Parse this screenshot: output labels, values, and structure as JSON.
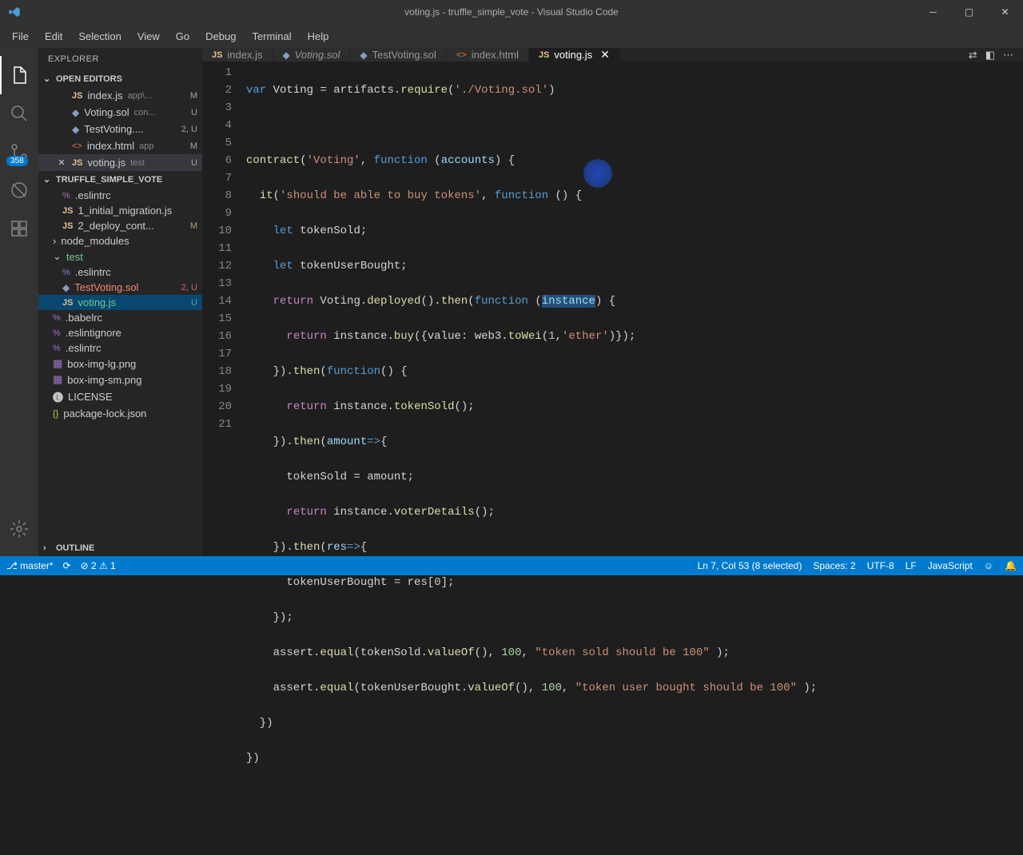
{
  "title": "voting.js - truffle_simple_vote - Visual Studio Code",
  "menu": [
    "File",
    "Edit",
    "Selection",
    "View",
    "Go",
    "Debug",
    "Terminal",
    "Help"
  ],
  "activitybar": {
    "scm_badge": "358"
  },
  "sidebar": {
    "title": "EXPLORER",
    "sections": {
      "open_editors": "OPEN EDITORS",
      "project": "TRUFFLE_SIMPLE_VOTE",
      "outline": "OUTLINE"
    },
    "open_editors": [
      {
        "name": "index.js",
        "meta": "app\\...",
        "status": "M",
        "icon": "js"
      },
      {
        "name": "Voting.sol",
        "meta": "con...",
        "status": "U",
        "icon": "sol"
      },
      {
        "name": "TestVoting....",
        "meta": "",
        "status": "2, U",
        "icon": "sol"
      },
      {
        "name": "index.html",
        "meta": "app",
        "status": "M",
        "icon": "html"
      },
      {
        "name": "voting.js",
        "meta": "test",
        "status": "U",
        "icon": "js",
        "close": true,
        "active": true
      }
    ],
    "tree": [
      {
        "name": ".eslintrc",
        "indent": 1,
        "icon": "yml"
      },
      {
        "name": "1_initial_migration.js",
        "indent": 1,
        "icon": "js"
      },
      {
        "name": "2_deploy_cont...",
        "indent": 1,
        "icon": "js",
        "status": "M",
        "cls": "modified"
      },
      {
        "name": "node_modules",
        "indent": 0,
        "folder": true,
        "chev": "›"
      },
      {
        "name": "test",
        "indent": 0,
        "folder": true,
        "chev": "⌄",
        "cls": "git-u"
      },
      {
        "name": ".eslintrc",
        "indent": 1,
        "icon": "yml"
      },
      {
        "name": "TestVoting.sol",
        "indent": 1,
        "icon": "sol",
        "status": "2, U",
        "cls": "error"
      },
      {
        "name": "voting.js",
        "indent": 1,
        "icon": "js",
        "status": "U",
        "active": true,
        "cls": "git-u"
      },
      {
        "name": ".babelrc",
        "indent": 0,
        "icon": "yml"
      },
      {
        "name": ".eslintignore",
        "indent": 0,
        "icon": "yml"
      },
      {
        "name": ".eslintrc",
        "indent": 0,
        "icon": "yml"
      },
      {
        "name": "box-img-lg.png",
        "indent": 0,
        "icon": "img"
      },
      {
        "name": "box-img-sm.png",
        "indent": 0,
        "icon": "img"
      },
      {
        "name": "LICENSE",
        "indent": 0,
        "icon": "file"
      },
      {
        "name": "package-lock.json",
        "indent": 0,
        "icon": "json"
      }
    ]
  },
  "tabs": [
    {
      "name": "index.js",
      "icon": "js"
    },
    {
      "name": "Voting.sol",
      "icon": "sol",
      "italic": true
    },
    {
      "name": "TestVoting.sol",
      "icon": "sol"
    },
    {
      "name": "index.html",
      "icon": "html"
    },
    {
      "name": "voting.js",
      "icon": "js",
      "active": true,
      "close": true
    }
  ],
  "code_lines": [
    "1",
    "2",
    "3",
    "4",
    "5",
    "6",
    "7",
    "8",
    "9",
    "10",
    "11",
    "12",
    "13",
    "14",
    "15",
    "16",
    "17",
    "18",
    "19",
    "20",
    "21"
  ],
  "code": {
    "l1a": "var",
    "l1b": " Voting ",
    "l1c": "=",
    "l1d": " artifacts.",
    "l1e": "require",
    "l1f": "(",
    "l1g": "'./Voting.sol'",
    "l1h": ")",
    "l3a": "contract",
    "l3b": "(",
    "l3c": "'Voting'",
    "l3d": ", ",
    "l3e": "function",
    "l3f": " (",
    "l3g": "accounts",
    "l3h": ") {",
    "l4a": "  ",
    "l4b": "it",
    "l4c": "(",
    "l4d": "'should be able to buy tokens'",
    "l4e": ", ",
    "l4f": "function",
    "l4g": " () {",
    "l5a": "    ",
    "l5b": "let",
    "l5c": " tokenSold;",
    "l6a": "    ",
    "l6b": "let",
    "l6c": " tokenUserBought;",
    "l7a": "    ",
    "l7b": "return",
    "l7c": " Voting.",
    "l7d": "deployed",
    "l7e": "().",
    "l7f": "then",
    "l7g": "(",
    "l7h": "function",
    "l7i": " (",
    "l7j": "instance",
    "l7k": ") {",
    "l8a": "      ",
    "l8b": "return",
    "l8c": " instance.",
    "l8d": "buy",
    "l8e": "({value: web3.",
    "l8f": "toWei",
    "l8g": "(",
    "l8h": "1",
    "l8i": ",",
    "l8j": "'ether'",
    "l8k": ")});",
    "l9a": "    }).",
    "l9b": "then",
    "l9c": "(",
    "l9d": "function",
    "l9e": "() {",
    "l10a": "      ",
    "l10b": "return",
    "l10c": " instance.",
    "l10d": "tokenSold",
    "l10e": "();",
    "l11a": "    }).",
    "l11b": "then",
    "l11c": "(",
    "l11d": "amount",
    "l11e": "=>",
    "l11f": "{",
    "l12a": "      tokenSold ",
    "l12b": "=",
    "l12c": " amount;",
    "l13a": "      ",
    "l13b": "return",
    "l13c": " instance.",
    "l13d": "voterDetails",
    "l13e": "();",
    "l14a": "    }).",
    "l14b": "then",
    "l14c": "(",
    "l14d": "res",
    "l14e": "=>",
    "l14f": "{",
    "l15a": "      tokenUserBought ",
    "l15b": "=",
    "l15c": " res[",
    "l15d": "0",
    "l15e": "];",
    "l16a": "    });",
    "l17a": "    assert.",
    "l17b": "equal",
    "l17c": "(tokenSold.",
    "l17d": "valueOf",
    "l17e": "(), ",
    "l17f": "100",
    "l17g": ", ",
    "l17h": "\"token sold should be 100\"",
    "l17i": " );",
    "l18a": "    assert.",
    "l18b": "equal",
    "l18c": "(tokenUserBought.",
    "l18d": "valueOf",
    "l18e": "(), ",
    "l18f": "100",
    "l18g": ", ",
    "l18h": "\"token user bought should be 100\"",
    "l18i": " );",
    "l19a": "  })",
    "l20a": "})"
  },
  "statusbar": {
    "branch": "master*",
    "errors": "2",
    "warnings": "1",
    "position": "Ln 7, Col 53 (8 selected)",
    "spaces": "Spaces: 2",
    "encoding": "UTF-8",
    "eol": "LF",
    "lang": "JavaScript"
  }
}
